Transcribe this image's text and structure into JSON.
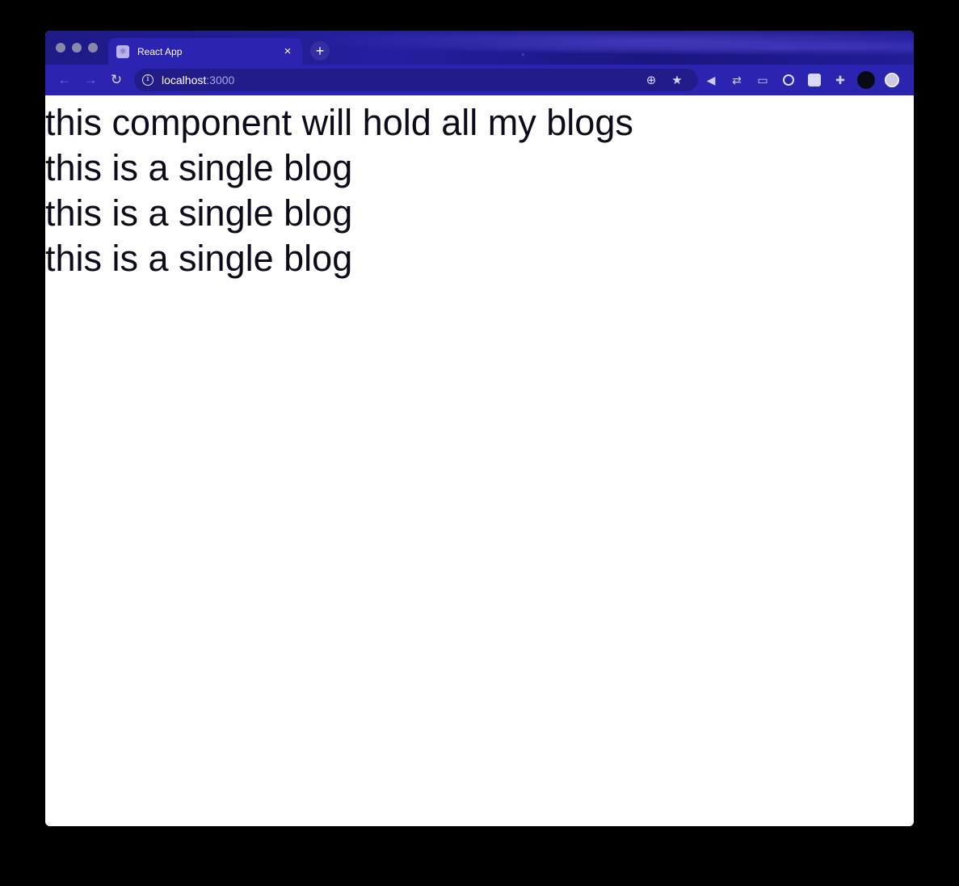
{
  "browser": {
    "tab": {
      "title": "React App",
      "favicon": "react-favicon-icon"
    },
    "new_tab_icon": "+",
    "close_tab_icon": "×",
    "address": {
      "host": "localhost",
      "port": ":3000"
    },
    "nav": {
      "back": "←",
      "forward": "→",
      "reload": "↻"
    },
    "omnibox_icons": {
      "zoom": "⊕",
      "bookmark": "★"
    },
    "extensions": [
      "mute-extension-icon",
      "link-extension-icon",
      "screen-extension-icon",
      "circle-extension-icon",
      "puzzle-extension-icon",
      "extensions-menu-icon",
      "dark-extension-icon",
      "profile-avatar-icon"
    ]
  },
  "page": {
    "heading": "this component will hold all my blogs",
    "blogs": [
      "this is a single blog",
      "this is a single blog",
      "this is a single blog"
    ]
  },
  "colors": {
    "titlebar": "#1e1a86",
    "toolbar": "#2b24b0",
    "page_background": "#ffffff",
    "page_text": "#0b0b1a"
  }
}
